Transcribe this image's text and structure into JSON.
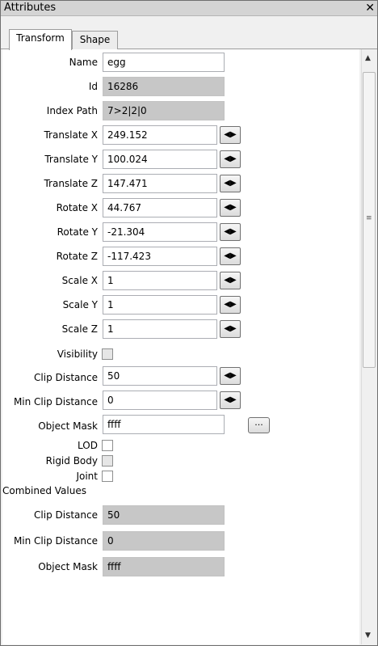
{
  "window": {
    "title": "Attributes",
    "close_glyph": "✕"
  },
  "tabs": [
    {
      "label": "Transform",
      "active": true
    },
    {
      "label": "Shape",
      "active": false
    }
  ],
  "transform": {
    "name": {
      "label": "Name",
      "value": "egg"
    },
    "id": {
      "label": "Id",
      "value": "16286"
    },
    "index_path": {
      "label": "Index Path",
      "value": "7>2|2|0"
    },
    "translate_x": {
      "label": "Translate X",
      "value": "249.152"
    },
    "translate_y": {
      "label": "Translate Y",
      "value": "100.024"
    },
    "translate_z": {
      "label": "Translate Z",
      "value": "147.471"
    },
    "rotate_x": {
      "label": "Rotate X",
      "value": "44.767"
    },
    "rotate_y": {
      "label": "Rotate Y",
      "value": "-21.304"
    },
    "rotate_z": {
      "label": "Rotate Z",
      "value": "-117.423"
    },
    "scale_x": {
      "label": "Scale X",
      "value": "1"
    },
    "scale_y": {
      "label": "Scale Y",
      "value": "1"
    },
    "scale_z": {
      "label": "Scale Z",
      "value": "1"
    },
    "visibility": {
      "label": "Visibility",
      "checked": false
    },
    "clip_distance": {
      "label": "Clip Distance",
      "value": "50"
    },
    "min_clip_distance": {
      "label": "Min Clip Distance",
      "value": "0"
    },
    "object_mask": {
      "label": "Object Mask",
      "value": "ffff",
      "button_label": "..."
    },
    "lod": {
      "label": "LOD",
      "checked": false
    },
    "rigid_body": {
      "label": "Rigid Body",
      "checked": false
    },
    "joint": {
      "label": "Joint",
      "checked": false
    }
  },
  "combined": {
    "section_title": "Combined Values",
    "clip_distance": {
      "label": "Clip Distance",
      "value": "50"
    },
    "min_clip_distance": {
      "label": "Min Clip Distance",
      "value": "0"
    },
    "object_mask": {
      "label": "Object Mask",
      "value": "ffff"
    }
  },
  "spinner_glyph": "◀▶",
  "icons": {
    "scroll_up": "scroll-up-arrow",
    "scroll_down": "scroll-down-arrow",
    "grip": "scroll-grip"
  }
}
